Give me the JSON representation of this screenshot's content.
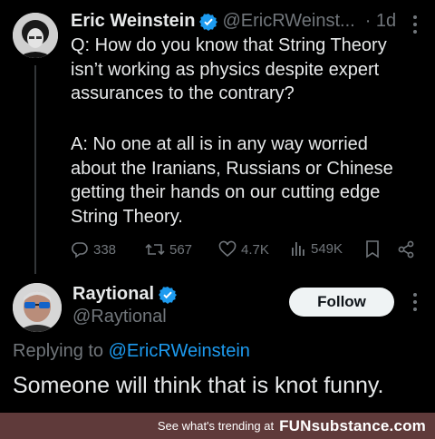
{
  "tweet": {
    "author_name": "Eric Weinstein",
    "handle": "@EricRWeinst...",
    "time": "· 1d",
    "more_icon": "more-vertical-icon",
    "text_q": "Q: How do you know that String Theory\nisn’t working as physics despite expert\nassurances to the contrary?",
    "text_a": "A: No one at all is in any way worried\nabout the Iranians, Russians or Chinese\ngetting their hands on our cutting edge\nString Theory.",
    "replies": "338",
    "retweets": "567",
    "likes": "4.7K",
    "views": "549K"
  },
  "reply": {
    "author_name": "Raytional",
    "handle": "@Raytional",
    "follow_label": "Follow",
    "replying_prefix": "Replying to ",
    "replying_to": "@EricRWeinstein",
    "text": "Someone will think that is knot funny."
  },
  "footer": {
    "text": "See what's trending at",
    "brand": "FUNsubstance.com"
  },
  "colors": {
    "background": "#000000",
    "text": "#e7e9ea",
    "muted": "#71767b",
    "link": "#1d9bf0",
    "verified": "#1d9bf0",
    "footer_bg": "#5f3a3a"
  }
}
